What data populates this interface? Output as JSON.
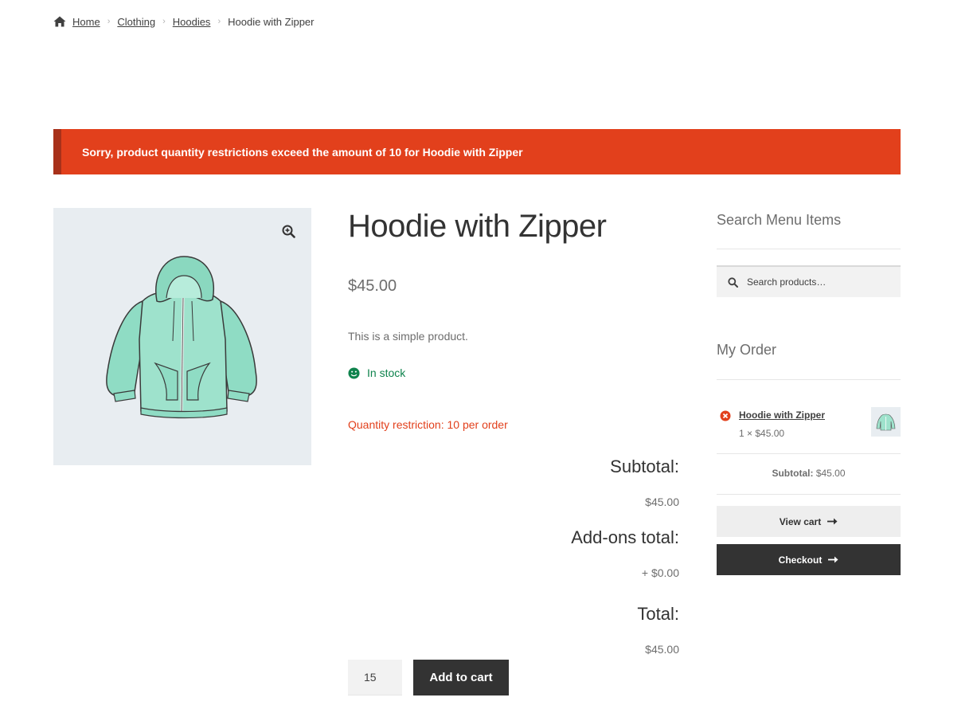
{
  "breadcrumb": {
    "items": [
      "Home",
      "Clothing",
      "Hoodies"
    ],
    "current": "Hoodie with Zipper",
    "icon": "home-icon"
  },
  "notice": {
    "error": "Sorry, product quantity restrictions exceed the amount of 10 for Hoodie with Zipper",
    "color": "#e2401c"
  },
  "product": {
    "title": "Hoodie with Zipper",
    "price": "$45.00",
    "short_description": "This is a simple product.",
    "stock": "In stock",
    "restriction": "Quantity restriction: 10 per order",
    "image_icon": "hoodie-image",
    "zoom_icon": "zoom-in-icon"
  },
  "totals": {
    "subtotal_label": "Subtotal:",
    "subtotal_value": "$45.00",
    "addons_label": "Add-ons total:",
    "addons_value": "+ $0.00",
    "total_label": "Total:",
    "total_value": "$45.00"
  },
  "cart_form": {
    "quantity": "15",
    "add_to_cart": "Add to cart"
  },
  "sidebar": {
    "search_heading": "Search Menu Items",
    "search_placeholder": "Search products…",
    "order_heading": "My Order",
    "cart_item": {
      "name": "Hoodie with Zipper",
      "quantity_price": "1 × $45.00"
    },
    "subtotal_label": "Subtotal:",
    "subtotal_value": "$45.00",
    "view_cart": "View cart",
    "checkout": "Checkout"
  },
  "colors": {
    "accent": "#333333",
    "success": "#0f834d",
    "danger": "#e2401c"
  }
}
